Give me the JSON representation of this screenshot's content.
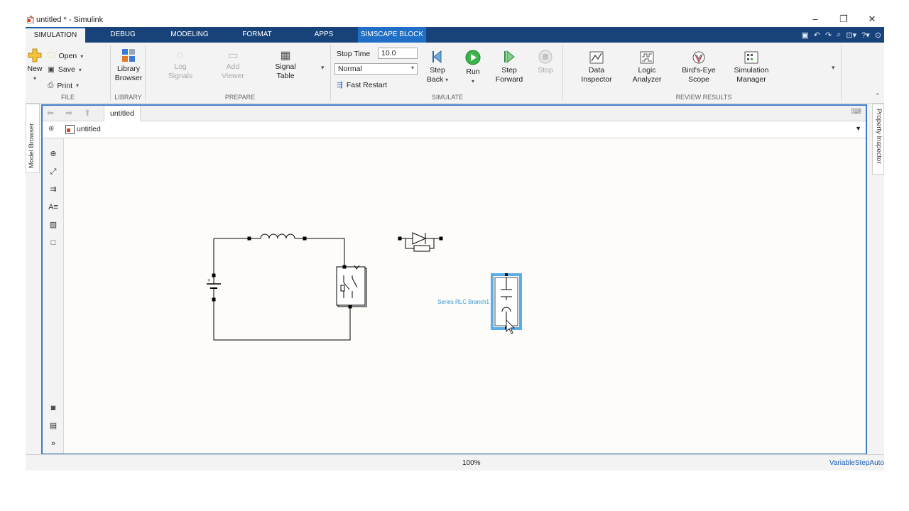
{
  "window": {
    "title": "untitled * - Simulink",
    "minimize": "–",
    "restore": "❐",
    "close": "✕"
  },
  "tabs": [
    {
      "label": "SIMULATION"
    },
    {
      "label": "DEBUG"
    },
    {
      "label": "MODELING"
    },
    {
      "label": "FORMAT"
    },
    {
      "label": "APPS"
    },
    {
      "label": "SIMSCAPE BLOCK"
    }
  ],
  "ribbon": {
    "file": {
      "label": "FILE",
      "new": "New",
      "open": "Open",
      "save": "Save",
      "print": "Print"
    },
    "library": {
      "label": "LIBRARY",
      "browser_line1": "Library",
      "browser_line2": "Browser"
    },
    "prepare": {
      "label": "PREPARE",
      "log_line1": "Log",
      "log_line2": "Signals",
      "add_line1": "Add",
      "add_line2": "Viewer",
      "signal_line1": "Signal",
      "signal_line2": "Table"
    },
    "simulate": {
      "label": "SIMULATE",
      "stop_time_label": "Stop Time",
      "stop_time_value": "10.0",
      "mode_value": "Normal",
      "fast_restart": "Fast Restart",
      "step_back_line1": "Step",
      "step_back_line2": "Back",
      "run": "Run",
      "step_fwd_line1": "Step",
      "step_fwd_line2": "Forward",
      "stop": "Stop"
    },
    "review": {
      "label": "REVIEW RESULTS",
      "data_line1": "Data",
      "data_line2": "Inspector",
      "logic_line1": "Logic",
      "logic_line2": "Analyzer",
      "birds_line1": "Bird's-Eye",
      "birds_line2": "Scope",
      "simman_line1": "Simulation",
      "simman_line2": "Manager"
    }
  },
  "side_tabs": {
    "model_browser": "Model Browser",
    "property_inspector": "Property Inspector"
  },
  "editor": {
    "model_tab": "untitled",
    "breadcrumb": "untitled"
  },
  "canvas": {
    "selected_block_label": "Series RLC Branch1",
    "colors": {
      "selection": "#5aaee8",
      "label": "#2e96d8",
      "wire": "#000000"
    }
  },
  "statusbar": {
    "zoom": "100%",
    "solver": "VariableStepAuto"
  }
}
